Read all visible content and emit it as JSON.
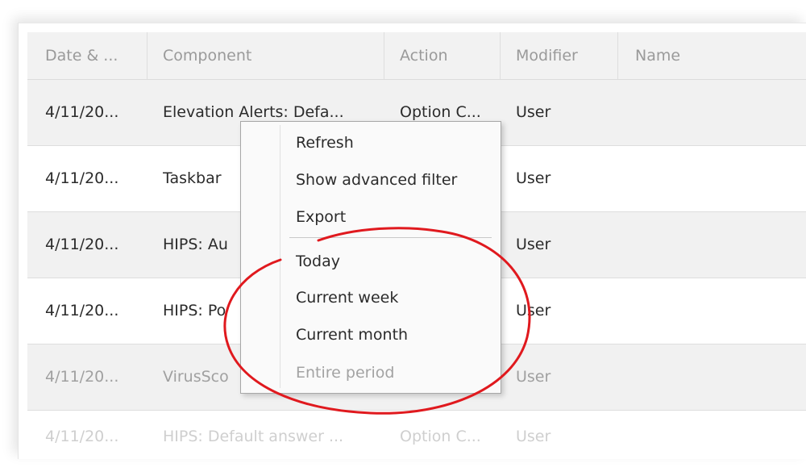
{
  "table": {
    "columns": [
      "Date & ...",
      "Component",
      "Action",
      "Modifier",
      "Name"
    ],
    "rows": [
      {
        "date": "4/11/20...",
        "component": "Elevation Alerts: Defa...",
        "action": "Option C...",
        "modifier": "User",
        "name": ""
      },
      {
        "date": "4/11/20...",
        "component": "Taskbar",
        "action": "",
        "modifier": "User",
        "name": ""
      },
      {
        "date": "4/11/20...",
        "component": "HIPS: Au",
        "action": "",
        "modifier": "User",
        "name": ""
      },
      {
        "date": "4/11/20...",
        "component": "HIPS: Po",
        "action": "",
        "modifier": "User",
        "name": ""
      },
      {
        "date": "4/11/20...",
        "component": "VirusSco",
        "action": "",
        "modifier": "User",
        "name": ""
      },
      {
        "date": "4/11/20...",
        "component": "HIPS: Default answer ...",
        "action": "Option C...",
        "modifier": "User",
        "name": ""
      }
    ]
  },
  "context_menu": {
    "items": [
      {
        "label": "Refresh",
        "enabled": true
      },
      {
        "label": "Show advanced filter",
        "enabled": true
      },
      {
        "label": "Export",
        "enabled": true
      },
      {
        "label": "Today",
        "enabled": true
      },
      {
        "label": "Current week",
        "enabled": true
      },
      {
        "label": "Current month",
        "enabled": true
      },
      {
        "label": "Entire period",
        "enabled": false
      }
    ]
  },
  "colors": {
    "annotation_ellipse": "#e0191e",
    "header_bg": "#f2f2f2",
    "alt_row_bg": "#f1f1f1"
  }
}
